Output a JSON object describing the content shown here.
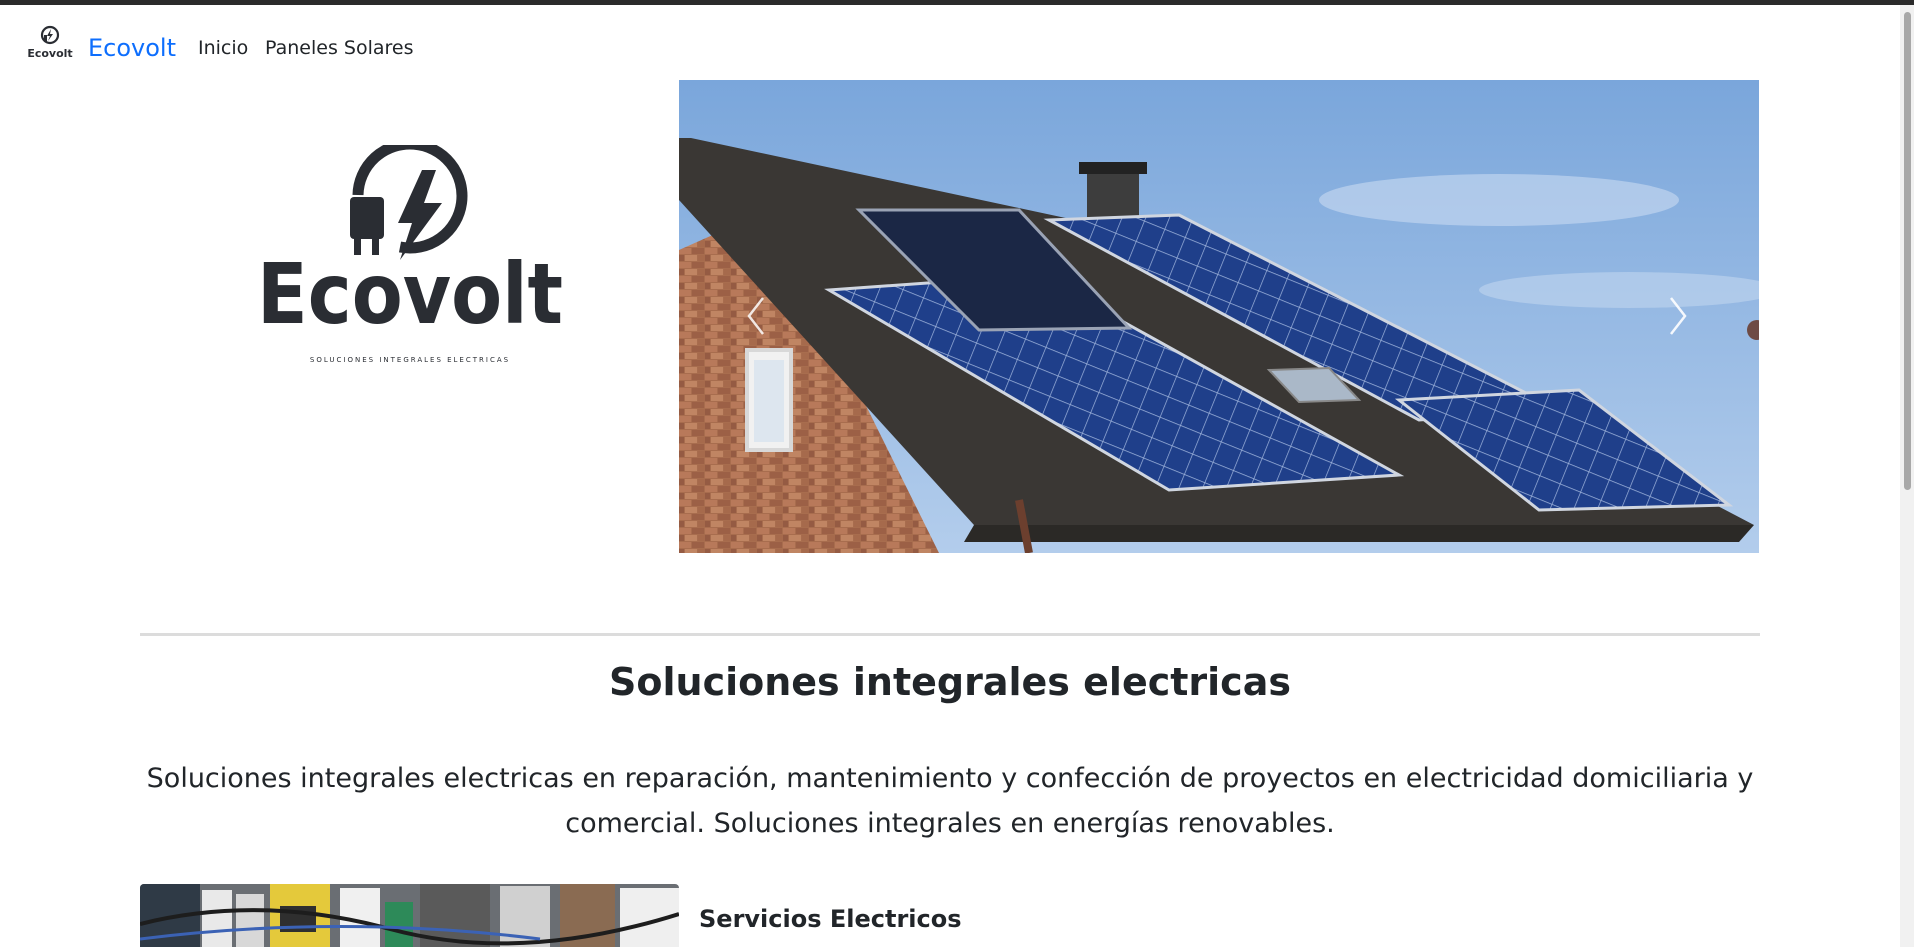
{
  "navbar": {
    "logo_text": "Ecovolt",
    "brand": "Ecovolt",
    "links": [
      "Inicio",
      "Paneles Solares"
    ]
  },
  "hero": {
    "logo_wordmark": "Ecovolt",
    "logo_tagline": "SOLUCIONES INTEGRALES ELECTRICAS"
  },
  "main": {
    "title": "Soluciones integrales electricas",
    "lead_line1": "Soluciones integrales electricas en reparación, mantenimiento y confección de proyectos en electricidad domiciliaria y",
    "lead_line2": "comercial. Soluciones integrales en energías renovables.",
    "service_title": "Servicios Electricos"
  },
  "icons": [
    "plug-bolt-logo-icon",
    "chevron-left-icon",
    "chevron-right-icon"
  ],
  "colors": {
    "brand": "#0d6efd",
    "logo": "#2a2d33",
    "text": "#212529"
  }
}
